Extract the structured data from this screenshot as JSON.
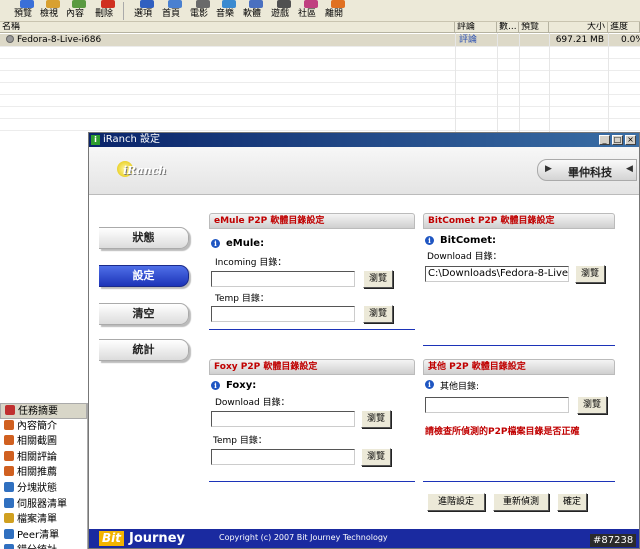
{
  "toolbar": {
    "items": [
      {
        "label": "預覽",
        "icon": "preview-icon",
        "color": "#3a6fd8"
      },
      {
        "label": "檢視",
        "icon": "view-icon",
        "color": "#d8a030"
      },
      {
        "label": "內容",
        "icon": "content-icon",
        "color": "#5a9a40"
      },
      {
        "label": "刪除",
        "icon": "delete-icon",
        "color": "#d03020"
      },
      {
        "label": "選項",
        "icon": "options-icon",
        "color": "#3060c0"
      },
      {
        "label": "首頁",
        "icon": "home-icon",
        "color": "#4a80d0"
      },
      {
        "label": "電影",
        "icon": "movie-icon",
        "color": "#6a6a6a"
      },
      {
        "label": "音樂",
        "icon": "music-icon",
        "color": "#3a8ad0"
      },
      {
        "label": "軟體",
        "icon": "software-icon",
        "color": "#4a70c0"
      },
      {
        "label": "遊戲",
        "icon": "game-icon",
        "color": "#505050"
      },
      {
        "label": "社區",
        "icon": "community-icon",
        "color": "#c04080"
      },
      {
        "label": "離開",
        "icon": "exit-icon",
        "color": "#e07020"
      }
    ]
  },
  "list": {
    "columns": [
      "名稱",
      "評論",
      "數...",
      "預覽",
      "大小",
      "進度"
    ],
    "rows": [
      {
        "name": "Fedora-8-Live-i686",
        "comment": "評論",
        "size": "697.21 MB",
        "progress": "0.0%"
      }
    ]
  },
  "tasks": [
    {
      "label": "任務摘要",
      "icon": "checklist-icon",
      "color": "#c03030"
    },
    {
      "label": "內容簡介",
      "icon": "content-brief-icon",
      "color": "#d06020"
    },
    {
      "label": "相關截圖",
      "icon": "screenshot-icon",
      "color": "#d06020"
    },
    {
      "label": "相關評論",
      "icon": "review-icon",
      "color": "#d06020"
    },
    {
      "label": "相關推薦",
      "icon": "recommend-icon",
      "color": "#d06020"
    },
    {
      "label": "分塊狀態",
      "icon": "block-status-icon",
      "color": "#3070c0"
    },
    {
      "label": "伺服器清單",
      "icon": "server-list-icon",
      "color": "#3070c0"
    },
    {
      "label": "檔案清單",
      "icon": "file-list-icon",
      "color": "#d0a020"
    },
    {
      "label": "Peer清單",
      "icon": "peer-list-icon",
      "color": "#3070c0"
    },
    {
      "label": "錯分統計",
      "icon": "stats-icon",
      "color": "#3070c0"
    }
  ],
  "dialog": {
    "title": "iRanch 設定",
    "logo_text": "iRanch",
    "brand": "畢仲科技",
    "nav": [
      "狀態",
      "設定",
      "清空",
      "統計"
    ],
    "emule": {
      "header": "eMule P2P 軟體目錄設定",
      "name": "eMule:",
      "incoming_label": "Incoming 目錄：",
      "incoming_value": "",
      "temp_label": "Temp 目錄：",
      "temp_value": ""
    },
    "bitcomet": {
      "header": "BitComet P2P 軟體目錄設定",
      "name": "BitComet:",
      "download_label": "Download 目錄：",
      "download_value": "C:\\Downloads\\Fedora-8-Live"
    },
    "foxy": {
      "header": "Foxy P2P 軟體目錄設定",
      "name": "Foxy:",
      "download_label": "Download 目錄：",
      "download_value": "",
      "temp_label": "Temp 目錄：",
      "temp_value": ""
    },
    "other": {
      "header": "其他 P2P 軟體目錄設定",
      "name": "其他目錄:",
      "dir_value": "",
      "warning": "請檢查所偵測的P2P檔案目錄是否正確"
    },
    "browse_label": "瀏覽",
    "buttons": {
      "advanced": "進階設定",
      "redetect": "重新偵測",
      "ok": "確定"
    },
    "footer": {
      "bit": "Bit",
      "journey": "Journey",
      "copyright": "Copyright (c) 2007 Bit Journey Technology"
    }
  },
  "watermark": "#87238"
}
